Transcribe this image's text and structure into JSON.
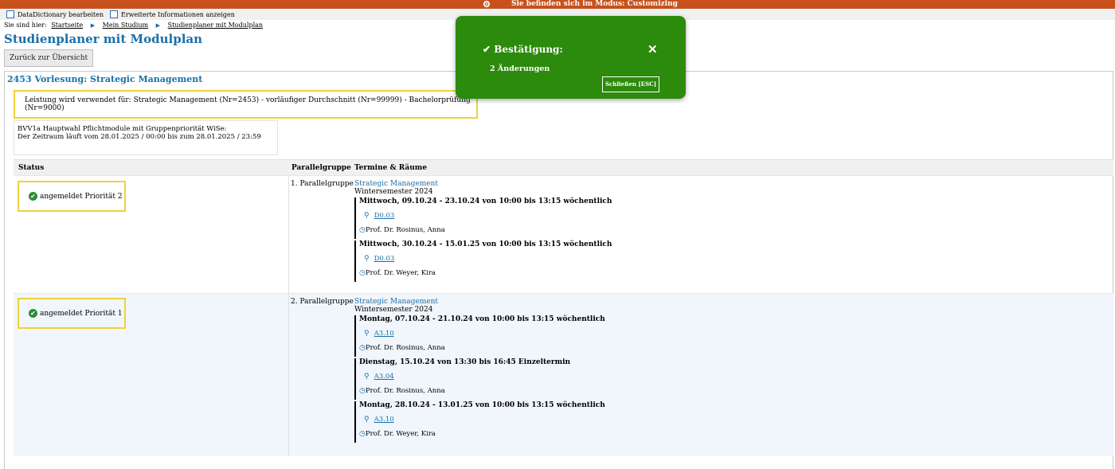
{
  "topbar": {
    "message": "Sie befinden sich im Modus: Customizing"
  },
  "toolbar": {
    "checkbox1_label": "DataDictionary bearbeiten",
    "checkbox2_label": "Erweiterte Informationen anzeigen"
  },
  "breadcrumb": {
    "prefix": "Sie sind hier:",
    "items": [
      "Startseite",
      "Mein Studium",
      "Studienplaner mit Modulplan"
    ]
  },
  "page_title": "Studienplaner mit Modulplan",
  "back_button": "Zurück zur Übersicht",
  "event": {
    "title": "2453 Vorlesung: Strategic Management",
    "usage": "Leistung wird verwendet für: Strategic Management (Nr=2453) - vorläufiger Durchschnitt (Nr=99999) - Bachelorprüfung (Nr=9000)",
    "period_line1": "BVV1a Hauptwahl Pflichtmodule mit Gruppenpriorität WiSe:",
    "period_line2": "Der Zeitraum läuft vom 28.01.2025 / 00:00 bis zum 28.01.2025 / 23:59"
  },
  "table": {
    "headers": {
      "status": "Status",
      "parallel": "Parallelgruppe",
      "termine": "Termine & Räume"
    },
    "rows": [
      {
        "status": "angemeldet Priorität 2",
        "parallel": "1. Parallelgruppe",
        "course": "Strategic Management",
        "semester": "Wintersemester 2024",
        "appointments": [
          {
            "when": "Mittwoch, 09.10.24 - 23.10.24 von 10:00 bis 13:15 wöchentlich",
            "room": "D0.03",
            "prof": "Prof. Dr. Rosinus, Anna"
          },
          {
            "when": "Mittwoch, 30.10.24 - 15.01.25 von 10:00 bis 13:15 wöchentlich",
            "room": "D0.03",
            "prof": "Prof. Dr. Weyer, Kira"
          }
        ]
      },
      {
        "status": "angemeldet Priorität 1",
        "parallel": "2. Parallelgruppe",
        "course": "Strategic Management",
        "semester": "Wintersemester 2024",
        "appointments": [
          {
            "when": "Montag, 07.10.24 - 21.10.24 von 10:00 bis 13:15 wöchentlich",
            "room": "A3.10",
            "prof": "Prof. Dr. Rosinus, Anna"
          },
          {
            "when": "Dienstag, 15.10.24 von 13:30 bis 16:45 Einzeltermin",
            "room": "A3.04",
            "prof": "Prof. Dr. Rosinus, Anna"
          },
          {
            "when": "Montag, 28.10.24 - 13.01.25 von 10:00 bis 13:15 wöchentlich",
            "room": "A3.10",
            "prof": "Prof. Dr. Weyer, Kira"
          }
        ]
      }
    ]
  },
  "toast": {
    "title": "Bestätigung:",
    "body": "2 Änderungen",
    "close_button": "Schließen [ESC]"
  },
  "colors": {
    "topbar": "#c8511b",
    "accent": "#1a6fa8",
    "toast": "#2c8a0c",
    "highlight": "#f0d13a"
  }
}
